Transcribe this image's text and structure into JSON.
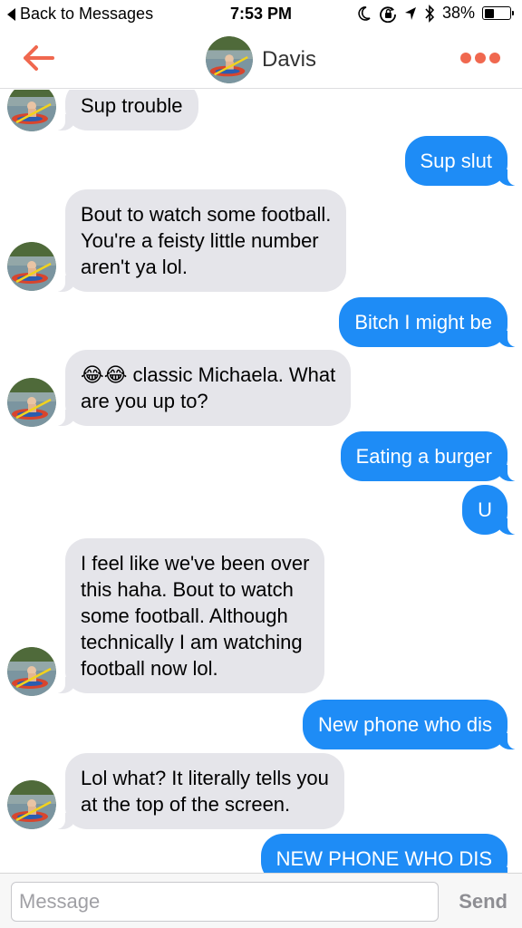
{
  "status_bar": {
    "back_label": "Back to Messages",
    "time": "7:53 PM",
    "battery_text": "38%",
    "battery_level": 0.38,
    "icons": [
      "moon-icon",
      "rotation-lock-icon",
      "location-arrow-icon",
      "bluetooth-icon",
      "battery-icon"
    ]
  },
  "header": {
    "contact_name": "Davis",
    "accent_color": "#f0684f",
    "icons": [
      "back-arrow-icon",
      "more-dots-icon"
    ]
  },
  "colors": {
    "incoming_bubble": "#e5e5ea",
    "outgoing_bubble": "#1e8cf6"
  },
  "messages": [
    {
      "direction": "incoming",
      "text": "Sup trouble"
    },
    {
      "direction": "outgoing",
      "text": "Sup slut"
    },
    {
      "direction": "incoming",
      "text": "Bout to watch some football.\nYou're a feisty little number\naren't ya lol."
    },
    {
      "direction": "outgoing",
      "text": "Bitch I might be"
    },
    {
      "direction": "incoming",
      "text": "😂😂 classic Michaela. What\nare you up to?"
    },
    {
      "direction": "outgoing",
      "text": "Eating a burger"
    },
    {
      "direction": "outgoing",
      "text": "U"
    },
    {
      "direction": "incoming",
      "text": "I feel like we've been over\nthis haha. Bout to watch\nsome football. Although\ntechnically I am watching\nfootball now lol."
    },
    {
      "direction": "outgoing",
      "text": "New phone who dis"
    },
    {
      "direction": "incoming",
      "text": "Lol what? It literally tells you\nat the top of the screen."
    },
    {
      "direction": "outgoing",
      "text": "NEW PHONE WHO DIS"
    }
  ],
  "composer": {
    "placeholder": "Message",
    "value": "",
    "send_label": "Send"
  }
}
